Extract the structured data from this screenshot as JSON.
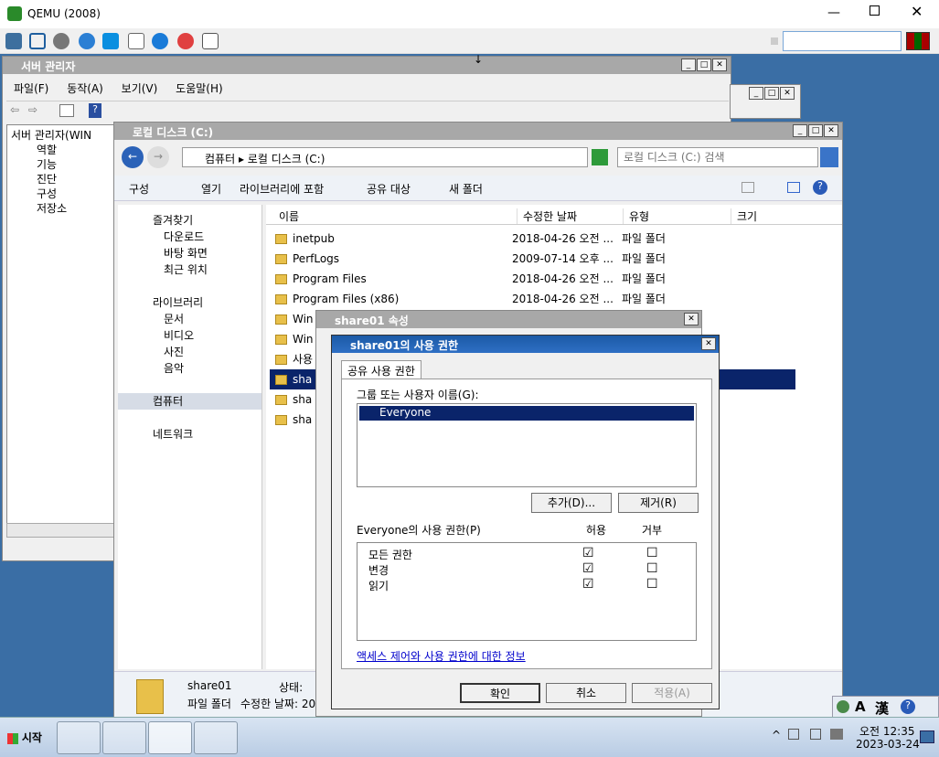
{
  "qemu": {
    "title": "QEMU (2008)"
  },
  "server_manager": {
    "title": "서버 관리자",
    "menu": [
      "파일(F)",
      "동작(A)",
      "보기(V)",
      "도움말(H)"
    ],
    "tree_root": "서버 관리자(WIN",
    "tree": [
      "역할",
      "기능",
      "진단",
      "구성",
      "저장소"
    ]
  },
  "explorer": {
    "title": "로컬 디스크 (C:)",
    "breadcrumb": [
      "컴퓨터",
      "로컬 디스크 (C:)"
    ],
    "search_placeholder": "로컬 디스크 (C:) 검색",
    "toolbar": [
      "구성",
      "열기",
      "라이브러리에 포함",
      "공유 대상",
      "새 폴더"
    ],
    "nav": {
      "favorites": "즐겨찾기",
      "favorites_items": [
        "다운로드",
        "바탕 화면",
        "최근 위치"
      ],
      "libraries": "라이브러리",
      "libraries_items": [
        "문서",
        "비디오",
        "사진",
        "음악"
      ],
      "computer": "컴퓨터",
      "network": "네트워크"
    },
    "columns": [
      "이름",
      "수정한 날짜",
      "유형",
      "크기"
    ],
    "files": [
      {
        "name": "inetpub",
        "date": "2018-04-26 오전 ...",
        "type": "파일 폴더"
      },
      {
        "name": "PerfLogs",
        "date": "2009-07-14 오후 ...",
        "type": "파일 폴더"
      },
      {
        "name": "Program Files",
        "date": "2018-04-26 오전 ...",
        "type": "파일 폴더"
      },
      {
        "name": "Program Files (x86)",
        "date": "2018-04-26 오전 ...",
        "type": "파일 폴더"
      },
      {
        "name": "Win",
        "date": "",
        "type": ""
      },
      {
        "name": "Win",
        "date": "",
        "type": ""
      },
      {
        "name": "사용",
        "date": "",
        "type": ""
      },
      {
        "name": "sha",
        "date": "",
        "type": ""
      },
      {
        "name": "sha",
        "date": "",
        "type": ""
      },
      {
        "name": "sha",
        "date": "",
        "type": ""
      }
    ],
    "details": {
      "name": "share01",
      "type": "파일 폴더",
      "status_label": "상태:",
      "modified_label": "수정한 날짜: 20"
    }
  },
  "props_dialog": {
    "title": "share01 속성"
  },
  "perm_dialog": {
    "title": "share01의 사용 권한",
    "tab": "공유 사용 권한",
    "group_label": "그룹 또는 사용자 이름(G):",
    "users": [
      "Everyone"
    ],
    "add_button": "추가(D)...",
    "remove_button": "제거(R)",
    "perm_label": "Everyone의 사용 권한(P)",
    "allow": "허용",
    "deny": "거부",
    "permissions": [
      {
        "name": "모든 권한",
        "allow": "☑",
        "deny": "☐"
      },
      {
        "name": "변경",
        "allow": "☑",
        "deny": "☐"
      },
      {
        "name": "읽기",
        "allow": "☑",
        "deny": "☐"
      }
    ],
    "link": "액세스 제어와 사용 권한에 대한 정보",
    "ok": "확인",
    "cancel": "취소",
    "apply": "적용(A)"
  },
  "taskbar": {
    "start": "시작",
    "ime_a": "A",
    "ime_han": "漢",
    "time": "오전 12:35",
    "date": "2023-03-24"
  },
  "colors": {
    "desktop": "#3a6ea5",
    "selection": "#0a246a",
    "link": "#0000cc"
  }
}
